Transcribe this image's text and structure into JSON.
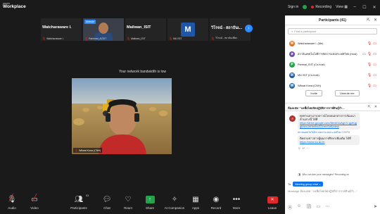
{
  "app": {
    "brand_small": "zoom",
    "brand": "Workplace"
  },
  "titlebar": {
    "signin": "Sign in",
    "recording": "Recording",
    "view": "View"
  },
  "strip": {
    "tiles": [
      {
        "name": "Watcharaware I.",
        "label": "Watcharaware I."
      },
      {
        "unmute": "Unmute",
        "label": "Parinmal_ACSIT"
      },
      {
        "name": "Mailwan_ISIT",
        "label": "Mailwan_ISIT"
      },
      {
        "logo": "M",
        "label": "MU ISIT"
      },
      {
        "name": "วิโรจน์ - สถาบันเ...",
        "label": "วิโรจน์ - สถาบันเฑียร"
      }
    ]
  },
  "bandwidth_notice": "Your network bandwidth is low",
  "speaker": {
    "label": "Wilwat Kuna (CNH)"
  },
  "toolbar": {
    "audio": "Audio",
    "video": "Video",
    "participants": "Participants",
    "participants_count": "41",
    "chat": "Chat",
    "react": "React",
    "share": "Share",
    "ai": "AI Companion",
    "apps": "Apps",
    "record": "Record",
    "more": "More",
    "leave": "Leave"
  },
  "participants_panel": {
    "title": "Participants (41)",
    "find_placeholder": "Find a participant",
    "list": [
      {
        "initial": "W",
        "color": "#e07020",
        "name": "Watcharaware I. (Me)"
      },
      {
        "initial": "ส",
        "color": "#6a4fb0",
        "name": "สถาบันเทคโนโลยีการจัดการแห่งประเทศไทย (Host)"
      },
      {
        "initial": "P",
        "color": "#22a34a",
        "name": "Parimal_ISIT (Co-host)"
      },
      {
        "initial": "M",
        "color": "#1f57a8",
        "name": "MU ISIT (Co-host)"
      },
      {
        "initial": "W",
        "color": "#2d6aa8",
        "name": "Wilwat Kuna (CNH)"
      }
    ],
    "invite": "Invite",
    "unmute_me": "Unmute me"
  },
  "chat_panel": {
    "title": "ห้องแชท \"วงเพื่อไทยจัดปฏิบัติการกาฬสินธุ์กำ...",
    "messages": [
      {
        "text": "ทุกท่านสามารถดาวน์โหลดเอกสารการสัมมนาด้านล่างนี้ ได้ที่",
        "link": "https://drive.google.com/file/d/1wAgCV-gyIKgjgbhcnJnHmfboZZcmvSnB/view"
      },
      {
        "meta_name": "สถาบันเทคโนโลยีการจัดการแห่งประเทศไทย",
        "meta_time": "2:28 PM",
        "text": "ติดตามข่าวสารผู้ทุนการศึกษาเพิ่มเติม ได้ที่",
        "link": "https://www.ku.ac.th"
      }
    ],
    "who_can_see": "Who can see your messages? Recording on",
    "to_label": "To:",
    "to_value": "Meeting group chat",
    "compose_placeholder": "Message ห้องแชท \"วงเพื่อไทยจัดปฏิบัติการกาฬสินธุ์กำ...\""
  }
}
